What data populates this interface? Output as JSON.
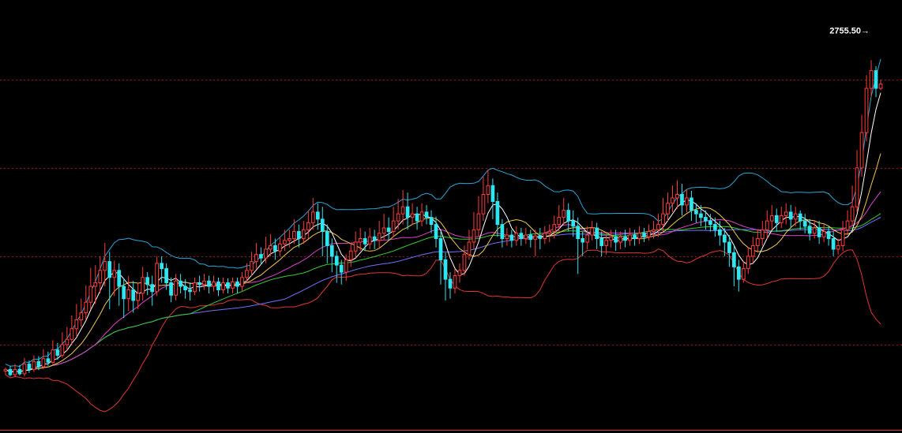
{
  "chart_data": {
    "type": "candlestick",
    "title": "",
    "xlabel": "",
    "ylabel": "",
    "ylim": [
      2300,
      2790
    ],
    "grid_levels": [
      2700,
      2600,
      2500,
      2400
    ],
    "grid": true,
    "annotation": {
      "text": "2755.50→",
      "value": 2755.5
    },
    "colors": {
      "background": "#000000",
      "up": "#ff3b3b",
      "down": "#2ee6f0",
      "grid": "#8b1a1a",
      "bb_upper": "#2aa6d8",
      "bb_lower": "#e33535",
      "ma5": "#ffffff",
      "ma10": "#f2c94c",
      "ma20": "#e040c8",
      "ma40": "#33cc33",
      "ma60": "#7070ff"
    },
    "candles": [
      [
        2370,
        2372,
        2366,
        2374
      ],
      [
        2372,
        2366,
        2364,
        2376
      ],
      [
        2366,
        2372,
        2363,
        2378
      ],
      [
        2372,
        2367,
        2365,
        2377
      ],
      [
        2367,
        2378,
        2364,
        2385
      ],
      [
        2378,
        2372,
        2368,
        2382
      ],
      [
        2372,
        2381,
        2369,
        2388
      ],
      [
        2381,
        2375,
        2371,
        2387
      ],
      [
        2375,
        2384,
        2372,
        2395
      ],
      [
        2384,
        2380,
        2376,
        2392
      ],
      [
        2380,
        2394,
        2378,
        2405
      ],
      [
        2394,
        2388,
        2383,
        2402
      ],
      [
        2388,
        2400,
        2385,
        2414
      ],
      [
        2400,
        2406,
        2393,
        2420
      ],
      [
        2406,
        2418,
        2401,
        2433
      ],
      [
        2418,
        2428,
        2410,
        2446
      ],
      [
        2428,
        2436,
        2420,
        2452
      ],
      [
        2436,
        2448,
        2428,
        2467
      ],
      [
        2448,
        2466,
        2440,
        2487
      ],
      [
        2466,
        2470,
        2446,
        2490
      ],
      [
        2470,
        2484,
        2458,
        2500
      ],
      [
        2484,
        2494,
        2466,
        2515
      ],
      [
        2494,
        2476,
        2440,
        2505
      ],
      [
        2476,
        2484,
        2455,
        2495
      ],
      [
        2484,
        2466,
        2444,
        2492
      ],
      [
        2466,
        2452,
        2430,
        2475
      ],
      [
        2452,
        2462,
        2438,
        2478
      ],
      [
        2462,
        2450,
        2436,
        2472
      ],
      [
        2450,
        2458,
        2440,
        2470
      ],
      [
        2458,
        2476,
        2450,
        2488
      ],
      [
        2476,
        2468,
        2456,
        2482
      ],
      [
        2468,
        2460,
        2444,
        2478
      ],
      [
        2460,
        2492,
        2455,
        2500
      ],
      [
        2492,
        2486,
        2470,
        2500
      ],
      [
        2486,
        2470,
        2462,
        2492
      ],
      [
        2470,
        2456,
        2448,
        2476
      ],
      [
        2456,
        2472,
        2450,
        2480
      ],
      [
        2472,
        2466,
        2458,
        2480
      ],
      [
        2466,
        2462,
        2452,
        2474
      ],
      [
        2462,
        2460,
        2450,
        2470
      ],
      [
        2460,
        2470,
        2456,
        2476
      ],
      [
        2470,
        2468,
        2460,
        2478
      ],
      [
        2468,
        2472,
        2462,
        2480
      ],
      [
        2472,
        2466,
        2458,
        2478
      ],
      [
        2466,
        2471,
        2460,
        2478
      ],
      [
        2471,
        2462,
        2455,
        2476
      ],
      [
        2462,
        2470,
        2458,
        2476
      ],
      [
        2470,
        2464,
        2458,
        2475
      ],
      [
        2464,
        2471,
        2458,
        2476
      ],
      [
        2471,
        2466,
        2458,
        2476
      ],
      [
        2466,
        2476,
        2460,
        2482
      ],
      [
        2476,
        2484,
        2470,
        2492
      ],
      [
        2484,
        2494,
        2478,
        2505
      ],
      [
        2494,
        2502,
        2486,
        2515
      ],
      [
        2502,
        2498,
        2490,
        2510
      ],
      [
        2498,
        2508,
        2492,
        2522
      ],
      [
        2508,
        2512,
        2500,
        2525
      ],
      [
        2512,
        2506,
        2496,
        2520
      ],
      [
        2506,
        2514,
        2500,
        2522
      ],
      [
        2514,
        2518,
        2506,
        2530
      ],
      [
        2518,
        2520,
        2510,
        2530
      ],
      [
        2520,
        2528,
        2514,
        2542
      ],
      [
        2528,
        2520,
        2510,
        2536
      ],
      [
        2520,
        2530,
        2514,
        2540
      ],
      [
        2530,
        2538,
        2520,
        2552
      ],
      [
        2538,
        2550,
        2530,
        2566
      ],
      [
        2550,
        2542,
        2530,
        2560
      ],
      [
        2542,
        2528,
        2500,
        2556
      ],
      [
        2528,
        2512,
        2492,
        2536
      ],
      [
        2512,
        2500,
        2482,
        2520
      ],
      [
        2500,
        2490,
        2470,
        2506
      ],
      [
        2490,
        2482,
        2468,
        2496
      ],
      [
        2482,
        2496,
        2472,
        2502
      ],
      [
        2496,
        2506,
        2488,
        2515
      ],
      [
        2506,
        2516,
        2498,
        2528
      ],
      [
        2516,
        2520,
        2506,
        2532
      ],
      [
        2520,
        2514,
        2506,
        2528
      ],
      [
        2514,
        2522,
        2508,
        2532
      ],
      [
        2522,
        2518,
        2508,
        2530
      ],
      [
        2518,
        2526,
        2510,
        2540
      ],
      [
        2526,
        2532,
        2518,
        2548
      ],
      [
        2532,
        2528,
        2518,
        2544
      ],
      [
        2528,
        2540,
        2522,
        2556
      ],
      [
        2540,
        2548,
        2530,
        2565
      ],
      [
        2548,
        2556,
        2536,
        2575
      ],
      [
        2556,
        2544,
        2530,
        2572
      ],
      [
        2544,
        2548,
        2536,
        2560
      ],
      [
        2548,
        2540,
        2530,
        2556
      ],
      [
        2540,
        2550,
        2534,
        2560
      ],
      [
        2550,
        2544,
        2536,
        2558
      ],
      [
        2544,
        2536,
        2526,
        2552
      ],
      [
        2536,
        2520,
        2510,
        2545
      ],
      [
        2520,
        2496,
        2468,
        2528
      ],
      [
        2496,
        2474,
        2450,
        2504
      ],
      [
        2474,
        2464,
        2452,
        2482
      ],
      [
        2464,
        2478,
        2458,
        2486
      ],
      [
        2478,
        2484,
        2470,
        2492
      ],
      [
        2484,
        2502,
        2478,
        2512
      ],
      [
        2502,
        2516,
        2496,
        2530
      ],
      [
        2516,
        2530,
        2508,
        2550
      ],
      [
        2530,
        2548,
        2522,
        2568
      ],
      [
        2548,
        2570,
        2540,
        2590
      ],
      [
        2570,
        2580,
        2560,
        2598
      ],
      [
        2580,
        2562,
        2542,
        2588
      ],
      [
        2562,
        2536,
        2522,
        2572
      ],
      [
        2536,
        2520,
        2510,
        2542
      ],
      [
        2520,
        2524,
        2512,
        2532
      ],
      [
        2524,
        2518,
        2510,
        2530
      ],
      [
        2518,
        2526,
        2512,
        2534
      ],
      [
        2526,
        2520,
        2512,
        2532
      ],
      [
        2520,
        2524,
        2514,
        2532
      ],
      [
        2524,
        2519,
        2510,
        2530
      ],
      [
        2519,
        2523,
        2500,
        2530
      ],
      [
        2523,
        2520,
        2508,
        2532
      ],
      [
        2520,
        2526,
        2514,
        2534
      ],
      [
        2526,
        2528,
        2516,
        2536
      ],
      [
        2528,
        2536,
        2520,
        2546
      ],
      [
        2536,
        2544,
        2528,
        2558
      ],
      [
        2544,
        2552,
        2536,
        2566
      ],
      [
        2552,
        2540,
        2528,
        2560
      ],
      [
        2540,
        2534,
        2522,
        2552
      ],
      [
        2534,
        2520,
        2480,
        2544
      ],
      [
        2520,
        2516,
        2500,
        2528
      ],
      [
        2516,
        2524,
        2508,
        2534
      ],
      [
        2524,
        2532,
        2518,
        2540
      ],
      [
        2532,
        2520,
        2508,
        2538
      ],
      [
        2520,
        2512,
        2500,
        2528
      ],
      [
        2512,
        2518,
        2502,
        2526
      ],
      [
        2518,
        2522,
        2510,
        2530
      ],
      [
        2522,
        2516,
        2506,
        2530
      ],
      [
        2516,
        2522,
        2508,
        2528
      ],
      [
        2522,
        2518,
        2510,
        2530
      ],
      [
        2518,
        2524,
        2512,
        2532
      ],
      [
        2524,
        2520,
        2512,
        2530
      ],
      [
        2520,
        2526,
        2514,
        2534
      ],
      [
        2526,
        2522,
        2516,
        2532
      ],
      [
        2522,
        2528,
        2518,
        2536
      ],
      [
        2528,
        2530,
        2520,
        2540
      ],
      [
        2530,
        2536,
        2522,
        2548
      ],
      [
        2536,
        2548,
        2528,
        2566
      ],
      [
        2548,
        2560,
        2540,
        2572
      ],
      [
        2560,
        2566,
        2550,
        2580
      ],
      [
        2566,
        2570,
        2554,
        2586
      ],
      [
        2570,
        2558,
        2546,
        2582
      ],
      [
        2558,
        2566,
        2550,
        2576
      ],
      [
        2566,
        2552,
        2540,
        2574
      ],
      [
        2552,
        2548,
        2538,
        2560
      ],
      [
        2548,
        2544,
        2534,
        2558
      ],
      [
        2544,
        2540,
        2530,
        2552
      ],
      [
        2540,
        2536,
        2528,
        2548
      ],
      [
        2536,
        2530,
        2522,
        2544
      ],
      [
        2530,
        2524,
        2512,
        2540
      ],
      [
        2524,
        2516,
        2500,
        2532
      ],
      [
        2516,
        2504,
        2488,
        2524
      ],
      [
        2504,
        2488,
        2466,
        2512
      ],
      [
        2488,
        2474,
        2460,
        2496
      ],
      [
        2474,
        2486,
        2470,
        2494
      ],
      [
        2486,
        2500,
        2480,
        2510
      ],
      [
        2500,
        2512,
        2492,
        2522
      ],
      [
        2512,
        2520,
        2504,
        2530
      ],
      [
        2520,
        2530,
        2512,
        2540
      ],
      [
        2530,
        2540,
        2520,
        2552
      ],
      [
        2540,
        2546,
        2530,
        2558
      ],
      [
        2546,
        2538,
        2528,
        2554
      ],
      [
        2538,
        2546,
        2532,
        2556
      ],
      [
        2546,
        2550,
        2536,
        2560
      ],
      [
        2550,
        2542,
        2532,
        2558
      ],
      [
        2542,
        2548,
        2534,
        2556
      ],
      [
        2548,
        2540,
        2530,
        2552
      ],
      [
        2540,
        2534,
        2526,
        2548
      ],
      [
        2534,
        2526,
        2518,
        2542
      ],
      [
        2526,
        2532,
        2520,
        2540
      ],
      [
        2532,
        2522,
        2514,
        2540
      ],
      [
        2522,
        2528,
        2516,
        2536
      ],
      [
        2528,
        2520,
        2512,
        2534
      ],
      [
        2520,
        2508,
        2500,
        2528
      ],
      [
        2508,
        2512,
        2502,
        2520
      ],
      [
        2512,
        2530,
        2506,
        2540
      ],
      [
        2530,
        2540,
        2524,
        2552
      ],
      [
        2540,
        2556,
        2534,
        2580
      ],
      [
        2556,
        2600,
        2550,
        2620
      ],
      [
        2600,
        2640,
        2590,
        2660
      ],
      [
        2640,
        2690,
        2630,
        2705
      ],
      [
        2690,
        2710,
        2680,
        2722
      ],
      [
        2710,
        2690,
        2680,
        2715
      ],
      [
        2690,
        2695,
        2688,
        2700
      ]
    ]
  }
}
